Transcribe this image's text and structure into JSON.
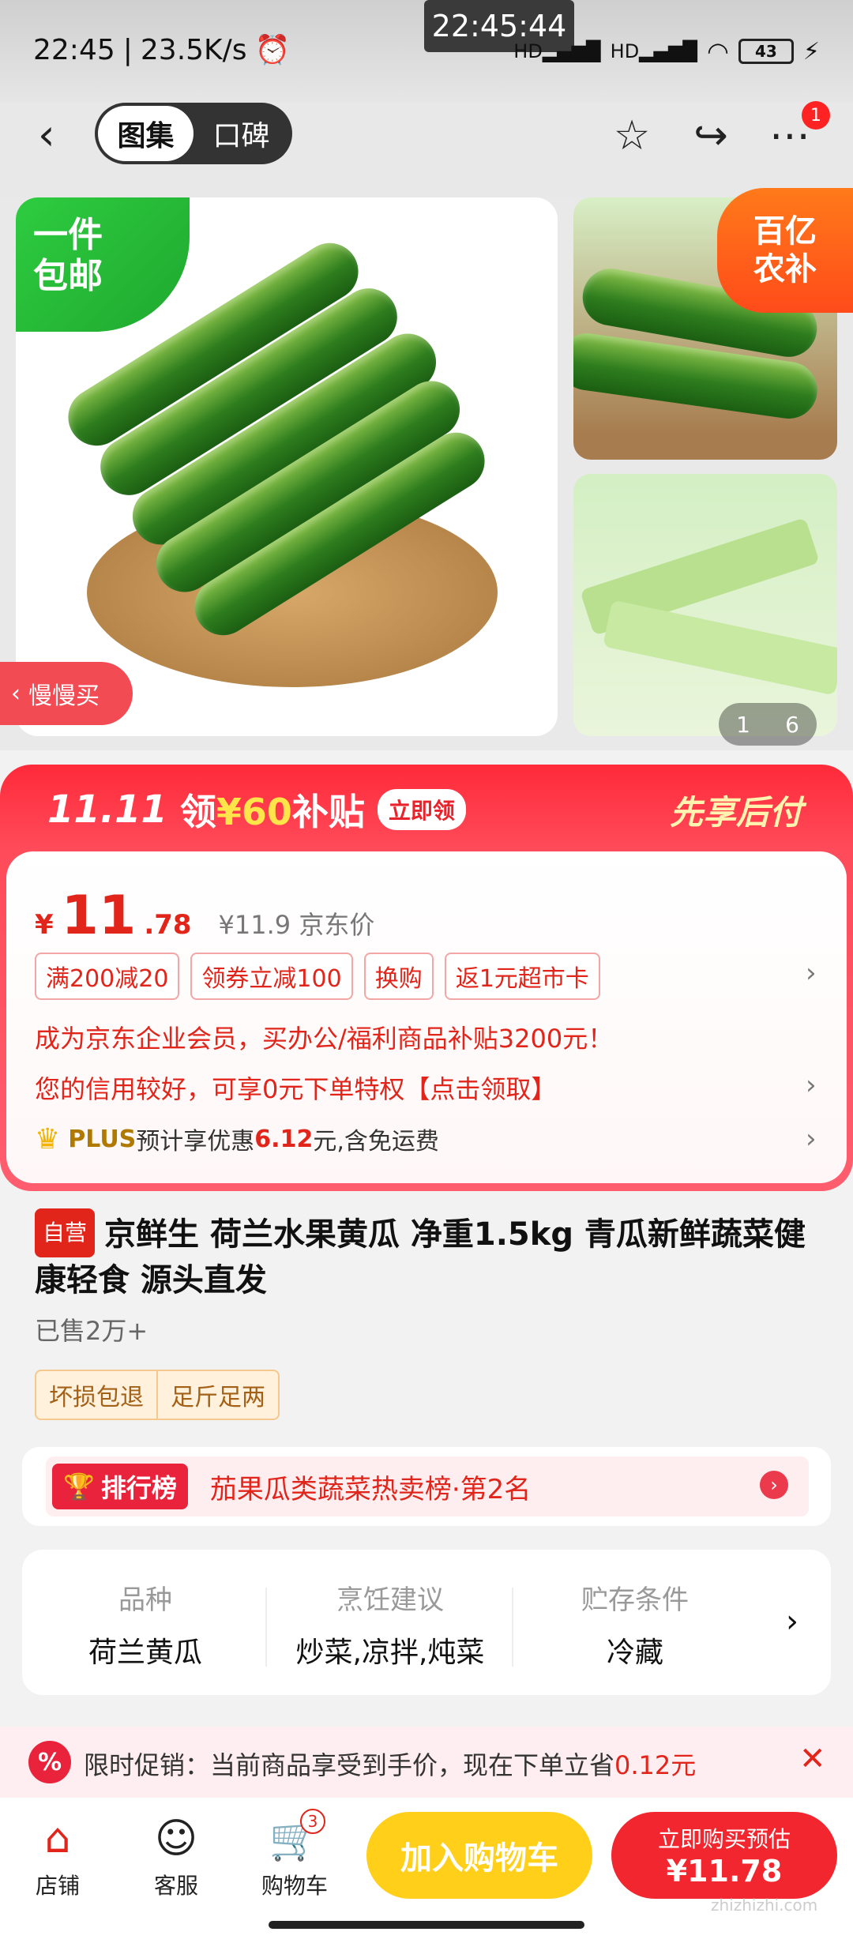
{
  "status": {
    "time": "22:45",
    "speed": "23.5K/s",
    "float_time": "22:45:44",
    "signal1": "HD",
    "signal2": "HD",
    "battery": "43"
  },
  "nav": {
    "tabs": [
      "图集",
      "口碑"
    ],
    "more_badge": "1"
  },
  "gallery": {
    "ship_tag_line1": "一件",
    "ship_tag_line2": "包邮",
    "subsidy_line1": "百亿",
    "subsidy_line2": "农补",
    "slow_buy": "慢慢买",
    "counter_current": "1",
    "counter_total": "6"
  },
  "promo": {
    "logo": "11.11",
    "title_prefix": "领",
    "amount": "¥60",
    "title_suffix": "补贴",
    "claim": "立即领",
    "pay_later": "先享后付"
  },
  "price": {
    "yen": "¥",
    "integer": "11",
    "decimal": ".78",
    "jd_price": "¥11.9 京东价",
    "coupons": [
      "满200减20",
      "领券立减100",
      "换购",
      "返1元超市卡"
    ],
    "enterprise_line": "成为京东企业会员，买办公/福利商品补贴3200元！",
    "credit_line": "您的信用较好，可享0元下单特权【点击领取】",
    "plus_word": "PLUS",
    "plus_mid": "预计享优惠",
    "plus_amt": "6.12",
    "plus_suffix": "元,含免运费"
  },
  "product": {
    "self_tag": "自营",
    "title": "京鲜生 荷兰水果黄瓜 净重1.5kg 青瓜新鲜蔬菜健康轻食 源头直发",
    "sold": "已售2万+",
    "service_tags": [
      "坏损包退",
      "足斤足两"
    ]
  },
  "rank": {
    "badge": "排行榜",
    "text": "茄果瓜类蔬菜热卖榜·第2名"
  },
  "specs": [
    {
      "label": "品种",
      "value": "荷兰黄瓜"
    },
    {
      "label": "烹饪建议",
      "value": "炒菜,凉拌,炖菜"
    },
    {
      "label": "贮存条件",
      "value": "冷藏"
    }
  ],
  "limited": {
    "icon": "%",
    "text": "限时促销：当前商品享受到手价，现在下单立省",
    "amount": "0.12元"
  },
  "bottom": {
    "store": "店铺",
    "service": "客服",
    "cart": "购物车",
    "cart_count": "3",
    "add_cart": "加入购物车",
    "buy_label": "立即购买预估",
    "buy_price": "¥11.78"
  },
  "watermark": "zhizhizhi.com",
  "colors": {
    "brand_red": "#e1251b",
    "cart_yellow": "#ffcf1a",
    "ship_green": "#2ecc40"
  }
}
